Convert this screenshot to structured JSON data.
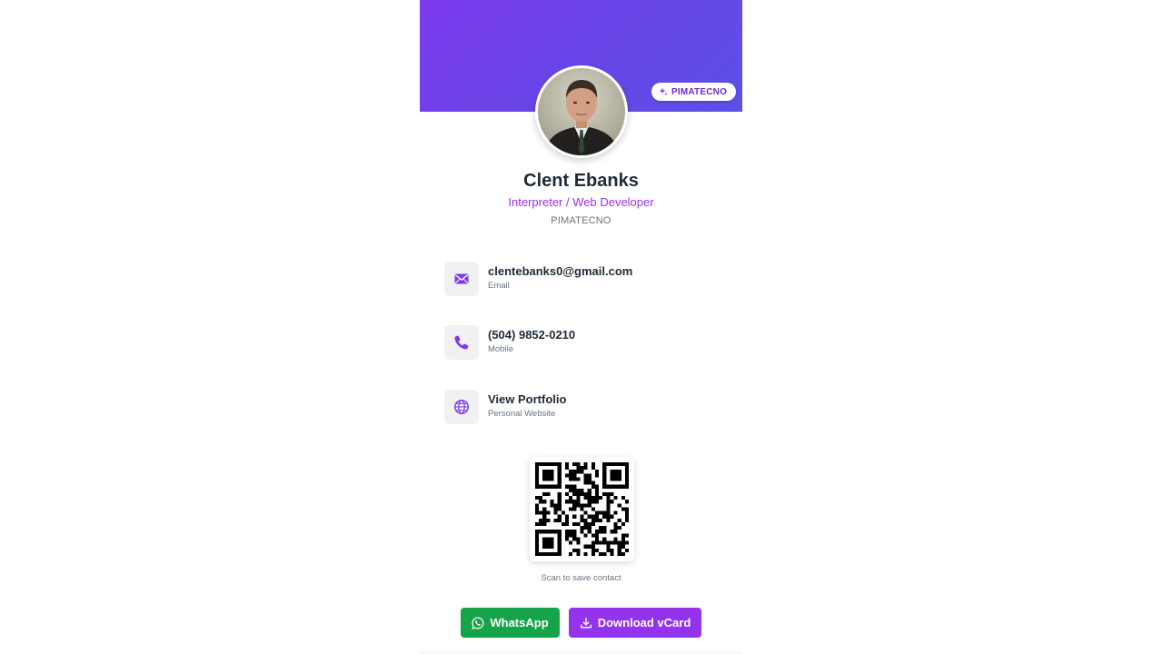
{
  "profile": {
    "name": "Clent Ebanks",
    "title": "Interpreter / Web Developer",
    "company": "PIMATECNO",
    "brand_badge": "PIMATECNO"
  },
  "contacts": [
    {
      "icon": "envelope-icon",
      "value": "clentebanks0@gmail.com",
      "label": "Email"
    },
    {
      "icon": "phone-icon",
      "value": "(504) 9852-0210",
      "label": "Mobile"
    },
    {
      "icon": "globe-icon",
      "value": "View Portfolio",
      "label": "Personal Website"
    }
  ],
  "qr": {
    "caption": "Scan to save contact"
  },
  "buttons": {
    "whatsapp": "WhatsApp",
    "vcard": "Download vCard"
  },
  "colors": {
    "banner_start": "#7c3aed",
    "banner_end": "#5b4fe6",
    "accent": "#9333ea",
    "whatsapp": "#16a34a"
  }
}
